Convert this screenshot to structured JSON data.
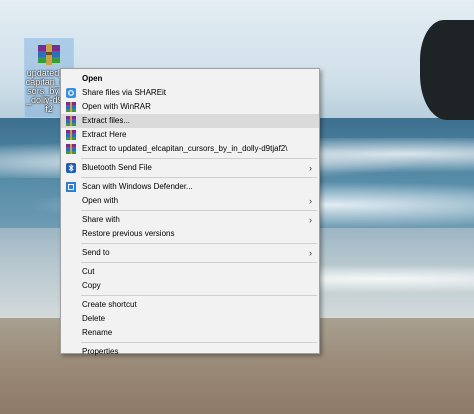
{
  "desktop_icon": {
    "label": "updated_elcapitan_cursors_by_in_dolly-d9tjaf2"
  },
  "context_menu": {
    "items": [
      {
        "label": "Open"
      },
      {
        "label": "Share files via SHAREit"
      },
      {
        "label": "Open with WinRAR"
      },
      {
        "label": "Extract files..."
      },
      {
        "label": "Extract Here"
      },
      {
        "label": "Extract to updated_elcapitan_cursors_by_in_dolly-d9tjaf2\\"
      },
      {
        "label": "Bluetooth Send File"
      },
      {
        "label": "Scan with Windows Defender..."
      },
      {
        "label": "Open with"
      },
      {
        "label": "Share with"
      },
      {
        "label": "Restore previous versions"
      },
      {
        "label": "Send to"
      },
      {
        "label": "Cut"
      },
      {
        "label": "Copy"
      },
      {
        "label": "Create shortcut"
      },
      {
        "label": "Delete"
      },
      {
        "label": "Rename"
      },
      {
        "label": "Properties"
      }
    ],
    "submenu_arrow": "›"
  }
}
